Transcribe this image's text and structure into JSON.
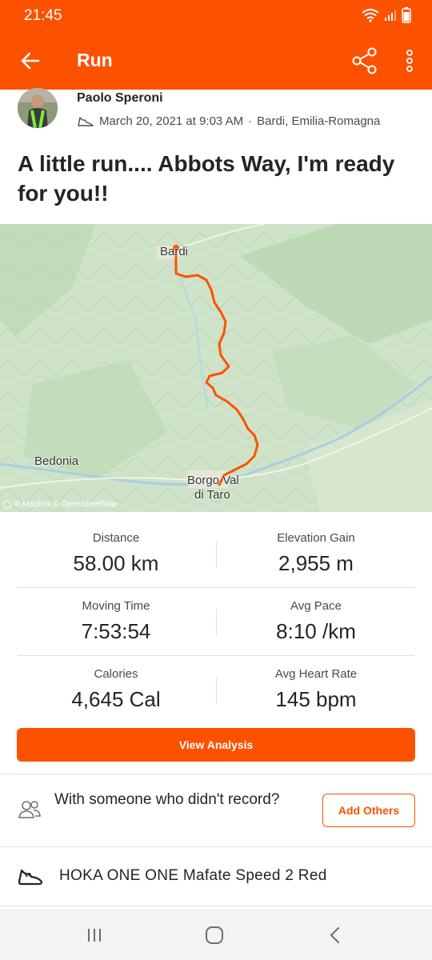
{
  "status_bar": {
    "time": "21:45",
    "icons": [
      "wifi-icon",
      "signal-icon",
      "battery-icon"
    ]
  },
  "app_bar": {
    "title": "Run",
    "back_icon": "arrow-left-icon",
    "share_icon": "share-icon",
    "more_icon": "more-vertical-icon"
  },
  "athlete": {
    "name": "Paolo Speroni",
    "date": "March 20, 2021 at 9:03 AM",
    "separator": "·",
    "location": "Bardi, Emilia-Romagna",
    "activity_icon": "running-shoe-icon"
  },
  "activity": {
    "title": "A little run.... Abbots Way, I'm ready for you!!"
  },
  "map": {
    "labels": {
      "bardi": "Bardi",
      "bedonia": "Bedonia",
      "borgo_line1": "Borgo Val",
      "borgo_line2": "di Taro"
    },
    "attribution": "© Mapbox © OpenStreetMap",
    "route_color": "#fc5200"
  },
  "stats": [
    {
      "label": "Distance",
      "value": "58.00 km"
    },
    {
      "label": "Elevation Gain",
      "value": "2,955 m"
    },
    {
      "label": "Moving Time",
      "value": "7:53:54"
    },
    {
      "label": "Avg Pace",
      "value": "8:10 /km"
    },
    {
      "label": "Calories",
      "value": "4,645 Cal"
    },
    {
      "label": "Avg Heart Rate",
      "value": "145 bpm"
    }
  ],
  "actions": {
    "view_analysis": "View Analysis",
    "with_others_text": "With someone who didn't record?",
    "add_others": "Add Others"
  },
  "gear": {
    "name": "HOKA ONE ONE Mafate Speed 2 Red",
    "icon": "shoe-icon"
  },
  "nav_bar": {
    "icons": [
      "recent-apps-icon",
      "home-icon",
      "back-nav-icon"
    ]
  },
  "colors": {
    "accent": "#fc5200",
    "text": "#242428",
    "muted": "#494950",
    "divider": "#dfdfe8"
  }
}
